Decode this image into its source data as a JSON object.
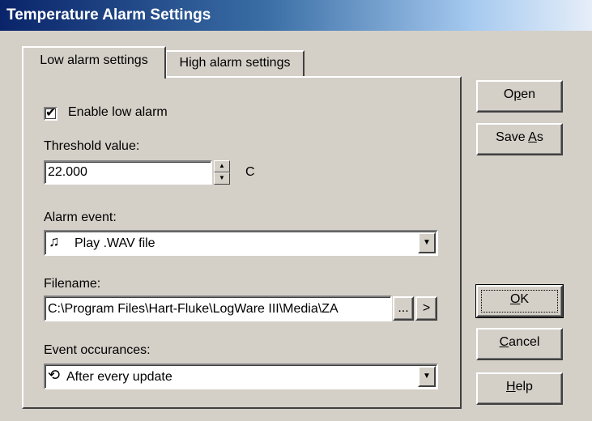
{
  "window": {
    "title": "Temperature Alarm Settings"
  },
  "tabs": [
    {
      "label": "Low alarm settings",
      "active": true
    },
    {
      "label": "High alarm settings",
      "active": false
    }
  ],
  "low_alarm": {
    "enable_label": "Enable low alarm",
    "enable_checked": true,
    "threshold_label": "Threshold value:",
    "threshold_value": "22.000",
    "threshold_unit": "C",
    "alarm_event_label": "Alarm event:",
    "alarm_event_value": "Play .WAV file",
    "alarm_event_icon": "music-note-icon",
    "filename_label": "Filename:",
    "filename_value": "C:\\Program Files\\Hart-Fluke\\LogWare III\\Media\\ZA",
    "browse_label": "...",
    "next_label": ">",
    "occurrences_label": "Event occurances:",
    "occurrences_value": "After every update",
    "occurrences_icon": "repeat-icon"
  },
  "buttons": {
    "open": {
      "pre": "O",
      "ul": "p",
      "post": "en"
    },
    "save_as": {
      "pre": "Save ",
      "ul": "A",
      "post": "s"
    },
    "ok": {
      "pre": "",
      "ul": "O",
      "post": "K"
    },
    "cancel": {
      "pre": "",
      "ul": "C",
      "post": "ancel"
    },
    "help": {
      "pre": "",
      "ul": "H",
      "post": "elp"
    }
  }
}
